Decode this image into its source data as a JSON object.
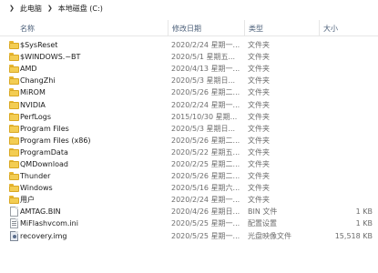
{
  "breadcrumb": {
    "items": [
      "此电脑",
      "本地磁盘 (C:)"
    ]
  },
  "columns": {
    "name": "名称",
    "date": "修改日期",
    "type": "类型",
    "size": "大小"
  },
  "files": [
    {
      "name": "$SysReset",
      "date": "2020/2/24 星期一...",
      "type": "文件夹",
      "size": "",
      "icon": "folder-icon"
    },
    {
      "name": "$WINDOWS.~BT",
      "date": "2020/5/1 星期五...",
      "type": "文件夹",
      "size": "",
      "icon": "folder-icon"
    },
    {
      "name": "AMD",
      "date": "2020/4/13 星期一...",
      "type": "文件夹",
      "size": "",
      "icon": "folder-icon"
    },
    {
      "name": "ChangZhi",
      "date": "2020/5/3 星期日...",
      "type": "文件夹",
      "size": "",
      "icon": "folder-icon"
    },
    {
      "name": "MiROM",
      "date": "2020/5/26 星期二...",
      "type": "文件夹",
      "size": "",
      "icon": "folder-icon"
    },
    {
      "name": "NVIDIA",
      "date": "2020/2/24 星期一...",
      "type": "文件夹",
      "size": "",
      "icon": "folder-icon"
    },
    {
      "name": "PerfLogs",
      "date": "2015/10/30 星期...",
      "type": "文件夹",
      "size": "",
      "icon": "folder-icon"
    },
    {
      "name": "Program Files",
      "date": "2020/5/3 星期日...",
      "type": "文件夹",
      "size": "",
      "icon": "folder-icon"
    },
    {
      "name": "Program Files (x86)",
      "date": "2020/5/26 星期二...",
      "type": "文件夹",
      "size": "",
      "icon": "folder-icon"
    },
    {
      "name": "ProgramData",
      "date": "2020/5/22 星期五...",
      "type": "文件夹",
      "size": "",
      "icon": "folder-icon"
    },
    {
      "name": "QMDownload",
      "date": "2020/2/25 星期二...",
      "type": "文件夹",
      "size": "",
      "icon": "folder-icon"
    },
    {
      "name": "Thunder",
      "date": "2020/5/26 星期二...",
      "type": "文件夹",
      "size": "",
      "icon": "folder-icon"
    },
    {
      "name": "Windows",
      "date": "2020/5/16 星期六...",
      "type": "文件夹",
      "size": "",
      "icon": "folder-icon"
    },
    {
      "name": "用户",
      "date": "2020/2/24 星期一...",
      "type": "文件夹",
      "size": "",
      "icon": "folder-icon"
    },
    {
      "name": "AMTAG.BIN",
      "date": "2020/4/26 星期日...",
      "type": "BIN 文件",
      "size": "1 KB",
      "icon": "file-icon"
    },
    {
      "name": "MiFlashvcom.ini",
      "date": "2020/5/25 星期一...",
      "type": "配置设置",
      "size": "1 KB",
      "icon": "ini-file-icon"
    },
    {
      "name": "recovery.img",
      "date": "2020/5/25 星期一...",
      "type": "光盘映像文件",
      "size": "15,518 KB",
      "icon": "disc-image-icon"
    }
  ]
}
